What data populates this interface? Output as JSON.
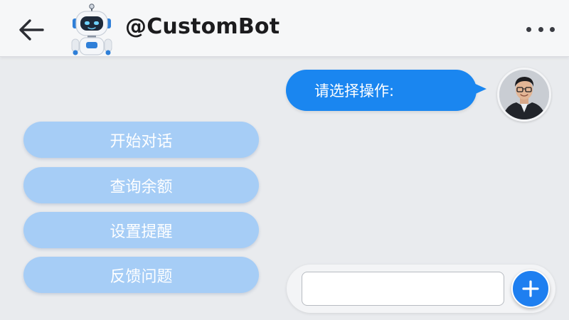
{
  "header": {
    "bot_name": "@CustomBot",
    "back_icon": "arrow-left-icon",
    "more_icon": "more-horizontal-icon"
  },
  "messages": [
    {
      "from": "user",
      "text": "请选择操作:"
    }
  ],
  "quick_options": [
    {
      "label": "开始对话"
    },
    {
      "label": "查询余额"
    },
    {
      "label": "设置提醒"
    },
    {
      "label": "反馈问题"
    }
  ],
  "composer": {
    "value": "",
    "placeholder": "",
    "send_icon": "plus-icon"
  },
  "colors": {
    "accent": "#1a86f0",
    "option_bg": "#a6cdf6",
    "background": "#e9ebee"
  }
}
